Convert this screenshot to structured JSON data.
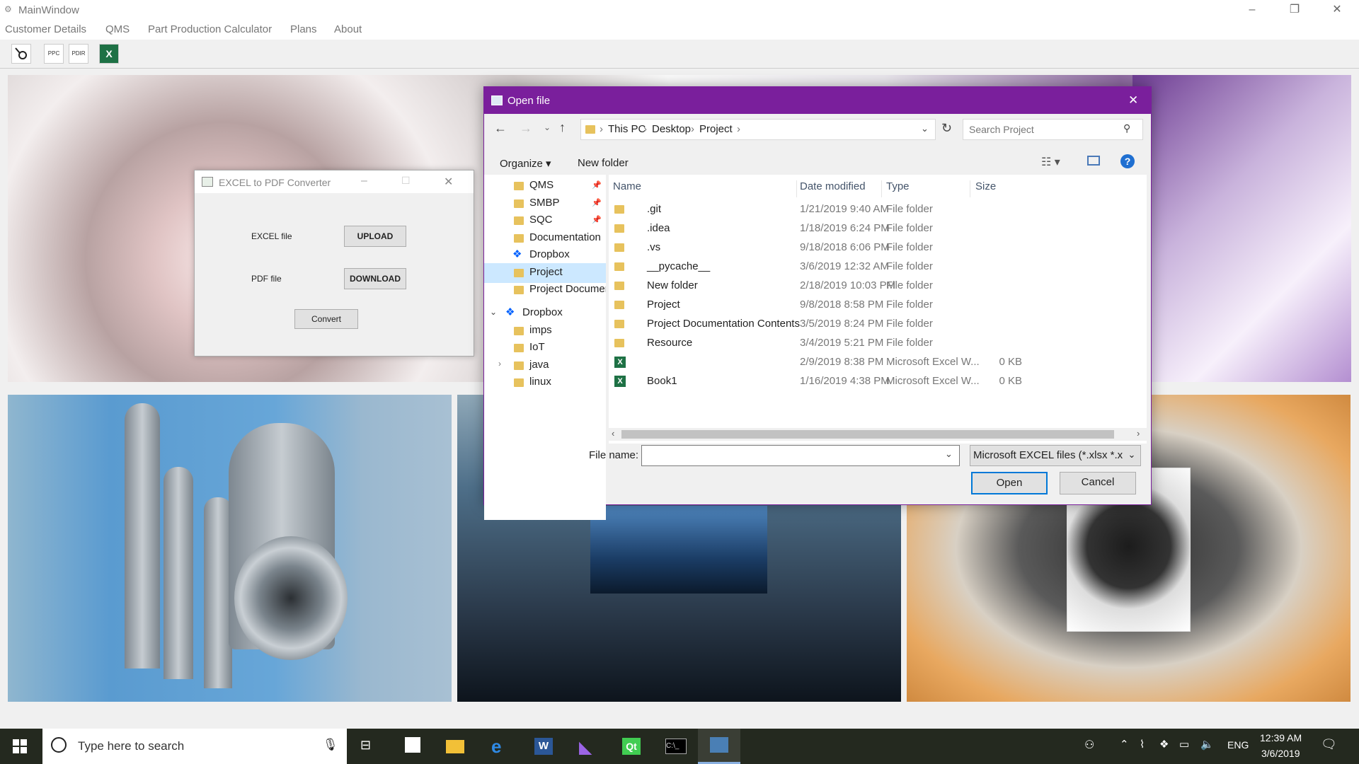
{
  "main_window": {
    "title": "MainWindow",
    "controls": {
      "minimize": "–",
      "maximize": "❐",
      "close": "✕"
    },
    "menu": [
      "Customer Details",
      "QMS",
      "Part Production Calculator",
      "Plans",
      "About"
    ],
    "toolbar": {
      "ppc": "PPC",
      "pdir": "PDIR",
      "excel": "X"
    }
  },
  "converter": {
    "title": "EXCEL to PDF Converter",
    "excel_label": "EXCEL file",
    "upload": "UPLOAD",
    "pdf_label": "PDF file",
    "download": "DOWNLOAD",
    "convert": "Convert"
  },
  "dialog": {
    "title": "Open file",
    "breadcrumbs": [
      "This PC",
      "Desktop",
      "Project"
    ],
    "search_placeholder": "Search Project",
    "organize": "Organize",
    "new_folder": "New folder",
    "nav_items": [
      {
        "label": "QMS",
        "pinned": true
      },
      {
        "label": "SMBP",
        "pinned": true
      },
      {
        "label": "SQC",
        "pinned": true
      },
      {
        "label": "Documentation",
        "pinned": false
      },
      {
        "label": "Dropbox",
        "pinned": false
      },
      {
        "label": "Project",
        "pinned": false
      },
      {
        "label": "Project Documer",
        "pinned": false
      },
      {
        "label": "Dropbox",
        "pinned": false
      },
      {
        "label": "imps",
        "pinned": false
      },
      {
        "label": "IoT",
        "pinned": false
      },
      {
        "label": "java",
        "pinned": false
      },
      {
        "label": "linux",
        "pinned": false
      }
    ],
    "columns": {
      "name": "Name",
      "date": "Date modified",
      "type": "Type",
      "size": "Size"
    },
    "files": [
      {
        "name": ".git",
        "date": "1/21/2019 9:40 AM",
        "type": "File folder",
        "size": "",
        "kind": "folder"
      },
      {
        "name": ".idea",
        "date": "1/18/2019 6:24 PM",
        "type": "File folder",
        "size": "",
        "kind": "folder"
      },
      {
        "name": ".vs",
        "date": "9/18/2018 6:06 PM",
        "type": "File folder",
        "size": "",
        "kind": "folder"
      },
      {
        "name": "__pycache__",
        "date": "3/6/2019 12:32 AM",
        "type": "File folder",
        "size": "",
        "kind": "folder"
      },
      {
        "name": "New folder",
        "date": "2/18/2019 10:03 PM",
        "type": "File folder",
        "size": "",
        "kind": "folder"
      },
      {
        "name": "Project",
        "date": "9/8/2018 8:58 PM",
        "type": "File folder",
        "size": "",
        "kind": "folder"
      },
      {
        "name": "Project Documentation Contents",
        "date": "3/5/2019 8:24 PM",
        "type": "File folder",
        "size": "",
        "kind": "folder"
      },
      {
        "name": "Resource",
        "date": "3/4/2019 5:21 PM",
        "type": "File folder",
        "size": "",
        "kind": "folder"
      },
      {
        "name": "",
        "date": "2/9/2019 8:38 PM",
        "type": "Microsoft Excel W...",
        "size": "0 KB",
        "kind": "excel"
      },
      {
        "name": "Book1",
        "date": "1/16/2019 4:38 PM",
        "type": "Microsoft Excel W...",
        "size": "0 KB",
        "kind": "excel"
      }
    ],
    "file_name_label": "File name:",
    "file_name_value": "",
    "filter": "Microsoft EXCEL files (*.xlsx *.xl",
    "open": "Open",
    "cancel": "Cancel"
  },
  "taskbar": {
    "search_placeholder": "Type here to search",
    "lang": "ENG",
    "time": "12:39 AM",
    "date": "3/6/2019"
  },
  "colors": {
    "dialog_accent": "#7a1f9c",
    "taskbar": "#24291f",
    "selection": "#cce8ff",
    "folder": "#e7c25d"
  }
}
